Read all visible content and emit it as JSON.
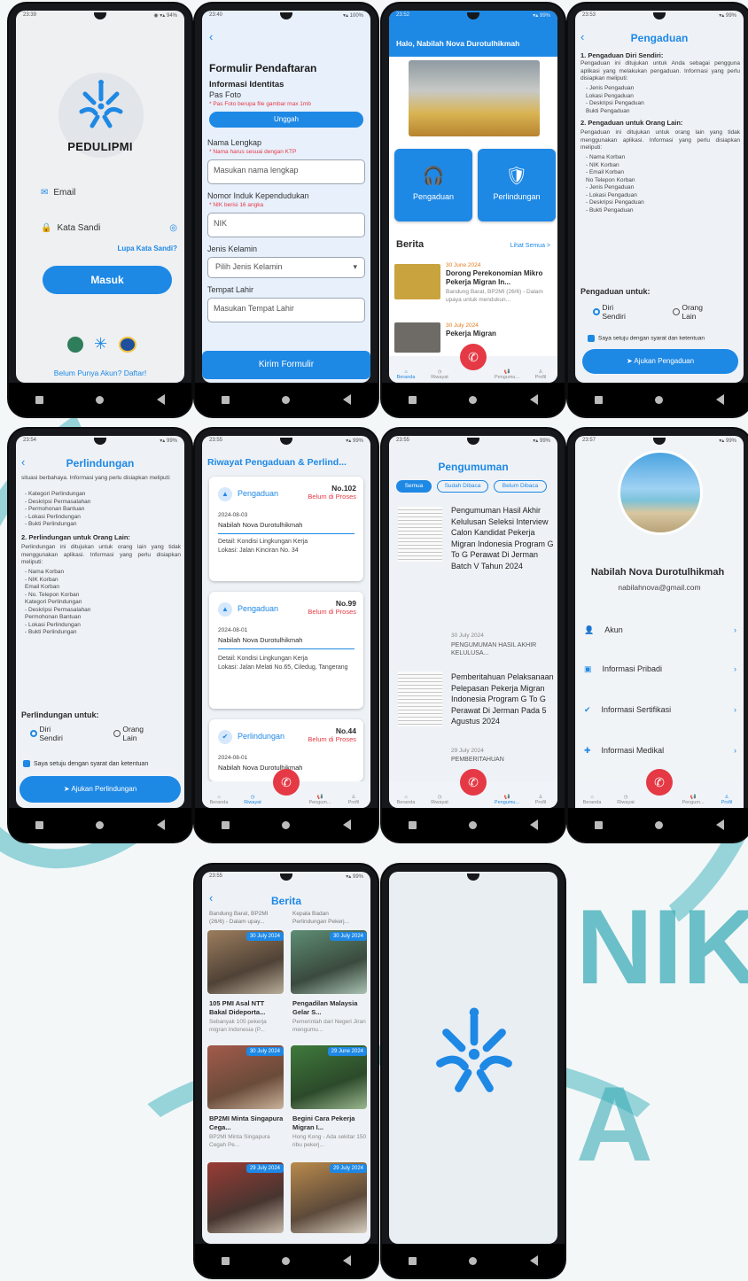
{
  "theme": {
    "accent": "#1e88e5",
    "danger": "#e53945",
    "watermark": "#4bb8c2"
  },
  "watermark": {
    "text1": "NIK",
    "text2": "A"
  },
  "login": {
    "status_time": "23:39",
    "brand": "PEDULIPMI",
    "email_label": "Email",
    "password_label": "Kata Sandi",
    "forgot": "Lupa Kata Sandi?",
    "login_button": "Masuk",
    "register": "Belum Punya Akun? Daftar!"
  },
  "register": {
    "status_time": "23:40",
    "title": "Formulir Pendaftaran",
    "section": "Informasi Identitas",
    "photo_label": "Pas Foto",
    "photo_hint": "* Pas Foto berupa file gambar max 1mb",
    "upload": "Unggah",
    "name_label": "Nama Lengkap",
    "name_hint": "* Nama harus sesuai dengan KTP",
    "name_placeholder": "Masukan nama lengkap",
    "nik_label": "Nomor Induk Kependudukan",
    "nik_hint": "* NIK berisi 16 angka",
    "nik_placeholder": "NIK",
    "gender_label": "Jenis Kelamin",
    "gender_placeholder": "Pilih Jenis Kelamin",
    "birthplace_label": "Tempat Lahir",
    "birthplace_placeholder": "Masukan Tempat Lahir",
    "submit": "Kirim Formulir"
  },
  "home": {
    "status_time": "23:52",
    "greeting": "Halo, Nabilah Nova Durotulhikmah",
    "menu_complaint": "Pengaduan",
    "menu_protection": "Perlindungan",
    "news_title": "Berita",
    "see_all": "Lihat Semua >",
    "news": [
      {
        "date": "30 June 2024",
        "title": "Dorong Perekonomian Mikro Pekerja Migran In...",
        "excerpt": "Bandung Barat, BP2MI (26/6) - Dalam upaya untuk mendukun..."
      },
      {
        "date": "30 July 2024",
        "title": "Pekerja Migran"
      }
    ],
    "nav": [
      "Beranda",
      "Riwayat",
      "Pengumu...",
      "Profil"
    ]
  },
  "complaint": {
    "status_time": "23:53",
    "title": "Pengaduan",
    "s1_title": "1. Pengaduan Diri Sendiri:",
    "s1_text": "Pengaduan ini ditujukan untuk Anda sebagai pengguna aplikasi yang melakukan pengaduan. Informasi yang perlu disiapkan meliputi:",
    "s1_items": [
      "- Jenis Pengaduan",
      "Lokasi Pengaduan",
      "- Deskripsi Pengaduan",
      "Bukti Pengaduan"
    ],
    "s2_title": "2. Pengaduan untuk Orang Lain:",
    "s2_text": "Pengaduan ini ditujukan untuk orang lain yang tidak menggunakan aplikasi. Informasi yang perlu disiapkan meliputi:",
    "s2_items": [
      "- Nama Korban",
      "- NIK Korban",
      "- Email Korban",
      "No Telepon Korban",
      "- Jenis Pengaduan",
      "- Lokasi Pengaduan",
      "- Deskripsi Pengaduan",
      "- Bukti Pengaduan"
    ],
    "for_label": "Pengaduan untuk:",
    "opt_self": "Diri Sendiri",
    "opt_other": "Orang Lain",
    "agree": "Saya setuju dengan syarat dan ketentuan",
    "submit": "Ajukan Pengaduan"
  },
  "protection": {
    "status_time": "23:54",
    "title": "Perlindungan",
    "intro": "situasi berbahaya. Informasi yang perlu disiapkan meliputi:",
    "s1_items": [
      "- Kategori Perlindungan",
      "- Deskripsi Permasalahan",
      "- Permohonan Bantuan",
      "- Lokasi Perlindungan",
      "- Bukti Perlindungan"
    ],
    "s2_title": "2. Perlindungan untuk Orang Lain:",
    "s2_text": "Perlindungan ini ditujukan untuk orang lain yang tidak menggunakan aplikasi. Informasi yang perlu disiapkan meliputi:",
    "s2_items": [
      "- Nama Korban",
      "- NIK Korban",
      "Email Korban",
      "- No. Telepon Korban",
      "Kategori Perlindungan",
      "- Deskripsi Permasalahan",
      "Permohonan Bantuan",
      "- Lokasi Perlindungan",
      "- Bukti Perlindungan"
    ],
    "for_label": "Perlindungan untuk:",
    "opt_self": "Diri Sendiri",
    "opt_other": "Orang Lain",
    "agree": "Saya setuju dengan syarat dan ketentuan",
    "submit": "Ajukan Perlindungan"
  },
  "history": {
    "status_time": "23:55",
    "title": "Riwayat Pengaduan & Perlind...",
    "items": [
      {
        "type": "Pengaduan",
        "no": "No.102",
        "status": "Belum di Proses",
        "date": "2024-08-03",
        "name": "Nabilah Nova Durotulhikmah",
        "detail": "Detail: Kondisi Lingkungan Kerja",
        "location": "Lokasi: Jalan Kinciran No. 34"
      },
      {
        "type": "Pengaduan",
        "no": "No.99",
        "status": "Belum di Proses",
        "date": "2024-08-01",
        "name": "Nabilah Nova Durotulhikmah",
        "detail": "Detail: Kondisi Lingkungan Kerja",
        "location": "Lokasi: Jalan Melati No.65, Ciledug, Tangerang"
      },
      {
        "type": "Perlindungan",
        "no": "No.44",
        "status": "Belum di Proses",
        "date": "2024-08-01",
        "name": "Nabilah Nova Durotulhikmah"
      }
    ],
    "nav": [
      "Beranda",
      "Riwayat",
      "Pengum...",
      "Profil"
    ]
  },
  "announce": {
    "status_time": "23:55",
    "title": "Pengumuman",
    "tabs": [
      "Semua",
      "Sudah Dibaca",
      "Belum Dibaca"
    ],
    "items": [
      {
        "title": "Pengumuman Hasil Akhir Kelulusan Seleksi Interview Calon Kandidat Pekerja Migran Indonesia Program G To G Perawat Di Jerman Batch V Tahun 2024",
        "date": "30 July 2024",
        "excerpt": "PENGUMUMAN HASIL AKHIR KELULUSA..."
      },
      {
        "title": "Pemberitahuan Pelaksanaan Pelepasan Pekerja Migran Indonesia Program G To G Perawat Di Jerman Pada 5 Agustus 2024",
        "date": "29 July 2024",
        "excerpt": "PEMBERITAHUAN"
      }
    ],
    "nav": [
      "Beranda",
      "Riwayat",
      "Pengumu...",
      "Profil"
    ]
  },
  "profile": {
    "status_time": "23:57",
    "name": "Nabilah Nova Durotulhikmah",
    "email": "nabilahnova@gmail.com",
    "menu": [
      "Akun",
      "Informasi Pribadi",
      "Informasi Sertifikasi",
      "Informasi Medikal"
    ],
    "nav": [
      "Beranda",
      "Riwayat",
      "Pengum...",
      "Profil"
    ]
  },
  "news": {
    "status_time": "23:55",
    "title": "Berita",
    "top": [
      "Bandung Barat, BP2MI (26/6) - Dalam upay...",
      "Kepala Badan Perlindungan Pekerj..."
    ],
    "items": [
      {
        "date": "30 July 2024",
        "title": "105 PMI Asal NTT Bakal Dideporta...",
        "excerpt": "Sebanyak 105 pekerja migran Indonesia (P..."
      },
      {
        "date": "30 July 2024",
        "title": "Pengadilan Malaysia Gelar S...",
        "excerpt": "Pemerintah dari Negeri Jiran mengumu..."
      },
      {
        "date": "30 July 2024",
        "title": "BP2MI Minta Singapura Cega...",
        "excerpt": "BP2MI Minta Singapura Cegah Pe..."
      },
      {
        "date": "29 June 2024",
        "title": "Begini Cara Pekerja Migran I...",
        "excerpt": "Hong Kong - Ada sekitar 150 ribu pekerj..."
      },
      {
        "date": "29 July 2024"
      },
      {
        "date": "29 July 2024"
      }
    ]
  }
}
